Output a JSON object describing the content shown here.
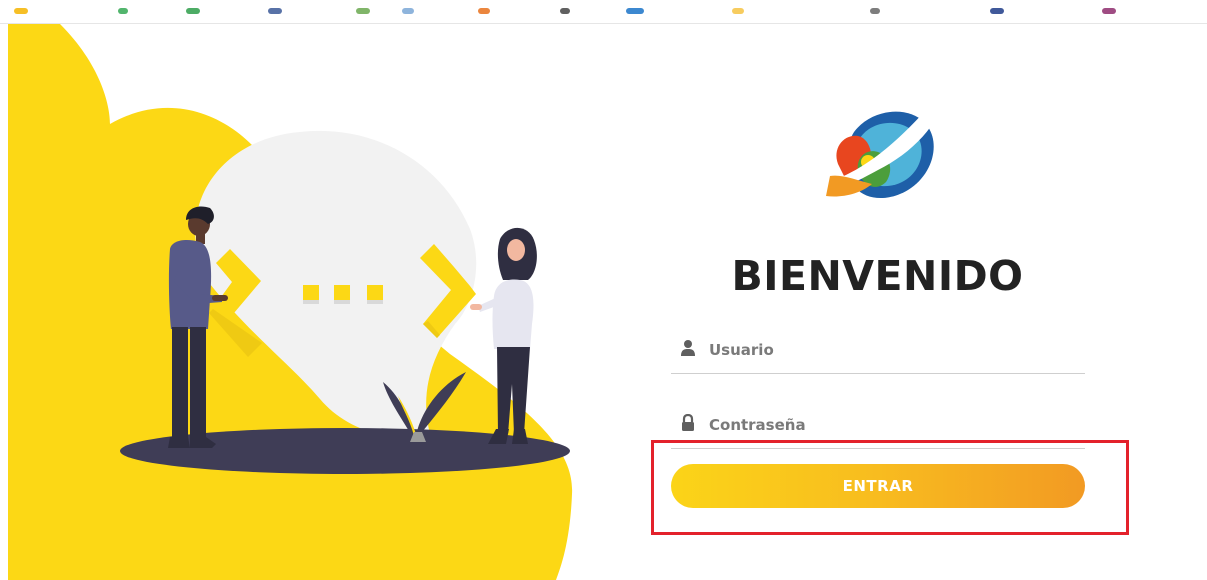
{
  "page": {
    "title": "BIENVENIDO"
  },
  "form": {
    "username_placeholder": "Usuario",
    "username_value": "",
    "password_placeholder": "Contraseña",
    "password_value": "",
    "submit_label": "ENTRAR"
  },
  "icons": {
    "user": "user-icon",
    "lock": "lock-icon",
    "logo": "brand-logo"
  },
  "colors": {
    "accent_start": "#fbd418",
    "accent_end": "#f29a23",
    "illustration_yellow": "#fcd815",
    "title": "#222222",
    "highlight": "#e3212b"
  }
}
